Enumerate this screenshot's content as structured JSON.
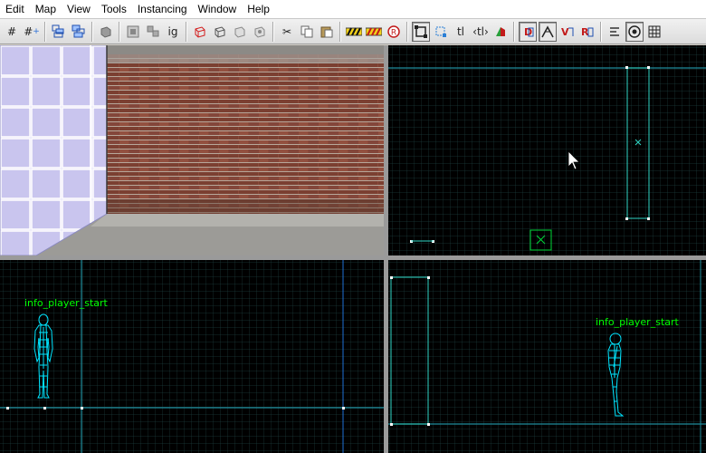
{
  "menu": [
    {
      "label": "Edit",
      "name": "menu-edit"
    },
    {
      "label": "Map",
      "name": "menu-map"
    },
    {
      "label": "View",
      "name": "menu-view"
    },
    {
      "label": "Tools",
      "name": "menu-tools"
    },
    {
      "label": "Instancing",
      "name": "menu-instancing"
    },
    {
      "label": "Window",
      "name": "menu-window"
    },
    {
      "label": "Help",
      "name": "menu-help"
    }
  ],
  "toolbar": {
    "texture_lock_label": "tl",
    "group_ignore_label": "ig"
  },
  "viewports": {
    "front_entity_label": "info_player_start",
    "side_entity_label": "info_player_start"
  },
  "colors": {
    "grid_minor": "#1a3a3a",
    "grid_major": "#205050",
    "axis_line": "#1f8b9b",
    "brush_outline": "#2fd6c6",
    "entity_wire": "#00e5ff",
    "entity_label": "#00ff00",
    "viewport_border": "#9a9a9a"
  }
}
